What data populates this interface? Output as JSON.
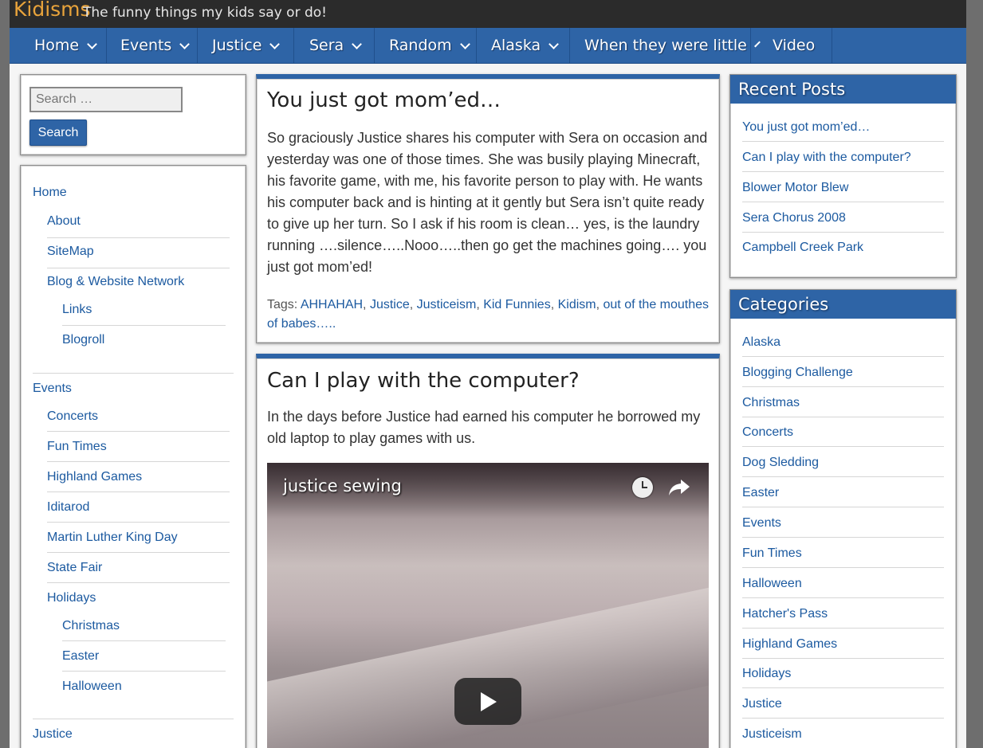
{
  "site": {
    "title": "Kidisms",
    "tagline": "The funny things my kids say or do!"
  },
  "nav": [
    "Home",
    "Events",
    "Justice",
    "Sera",
    "Random",
    "Alaska",
    "When they were little",
    "Video"
  ],
  "search": {
    "placeholder": "Search …",
    "button": "Search"
  },
  "page_menu": [
    "Home",
    "About",
    "SiteMap",
    "Blog & Website Network",
    "Links",
    "Blogroll",
    "Events",
    "Concerts",
    "Fun Times",
    "Highland Games",
    "Iditarod",
    "Martin Luther King Day",
    "State Fair",
    "Holidays",
    "Christmas",
    "Easter",
    "Halloween",
    "Justice"
  ],
  "posts": [
    {
      "title": "You just got mom’ed…",
      "text": "So graciously Justice shares his computer with Sera on occasion and yesterday was one of those times. She was busily playing Minecraft, his favorite game, with me, his favorite person to play with. He wants his computer back and is hinting at it gently but Sera isn’t quite ready to give up her turn. So I ask if his room is clean… yes, is the laundry running ….silence…..Nooo…..then go get the machines going…. you just got mom’ed!",
      "tags_label": "Tags:",
      "tags": [
        "AHHAHAH",
        "Justice",
        "Justiceism",
        "Kid Funnies",
        "Kidism",
        "out of the mouthes of babes….."
      ]
    },
    {
      "title": "Can I play with the computer?",
      "text": "In the days before Justice had earned his computer he borrowed my old laptop to play games with us.",
      "video_title": "justice sewing"
    }
  ],
  "recent_posts": {
    "heading": "Recent Posts",
    "items": [
      "You just got mom’ed…",
      "Can I play with the computer?",
      "Blower Motor Blew",
      "Sera Chorus 2008",
      "Campbell Creek Park"
    ]
  },
  "categories": {
    "heading": "Categories",
    "items": [
      "Alaska",
      "Blogging Challenge",
      "Christmas",
      "Concerts",
      "Dog Sledding",
      "Easter",
      "Events",
      "Fun Times",
      "Halloween",
      "Hatcher's Pass",
      "Highland Games",
      "Holidays",
      "Justice",
      "Justiceism"
    ]
  },
  "colors": {
    "accent": "#2e64a6",
    "title": "#e8a33b",
    "link": "#1c5aa0"
  }
}
